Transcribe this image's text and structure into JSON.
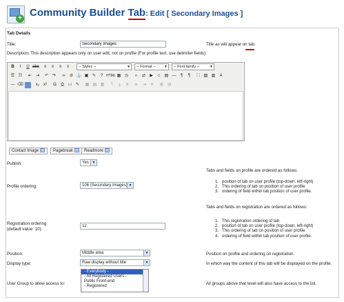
{
  "header": {
    "title_prefix": "Community Builder",
    "title_tab": "Tab",
    "title_suffix": ": Edit [ Secondary Images ]"
  },
  "section": "Tab Details",
  "fields": {
    "title_label": "Title:",
    "title_value": "Secondary Images",
    "title_help_pre": "Title as will appear on ",
    "title_help_tab": "tab",
    "title_help_end": ".",
    "desc_label": "Description: This description appears only on user edit, not on profile (For profile text, use delimiter fields):"
  },
  "editor": {
    "styles": "-- Styles --",
    "format": "-- Format --",
    "font": "-- Font family --",
    "buttons": [
      "Contact Image",
      "Pagebreak",
      "Readmore"
    ]
  },
  "publish": {
    "label": "Publish:",
    "value": "Yes"
  },
  "profile_ordering": {
    "label": "Profile ordering:",
    "value": "106 (Secondary Images)",
    "heading": "Tabs and fields on profile are ordered as follows:",
    "items": [
      "position of tab on user profile (top-down, left-right)",
      "This ordering of tab on position of user profile",
      "ordering of field within tab position of user profile."
    ]
  },
  "registration_ordering": {
    "label": "Registration ordering",
    "label2": "(default value: 10):",
    "value": "12",
    "heading": "Tabs and fields on registration are ordered as follows:",
    "items": [
      "This registration ordering of tab",
      "position of tab on user profile (top-down, left-right)",
      "This ordering of tab on position of user profile",
      "ordering of field within tab position of user profile."
    ]
  },
  "position": {
    "label": "Position:",
    "value": "Middle area",
    "help": "Position on profile and ordering on registration."
  },
  "display_type": {
    "label": "Display type:",
    "value": "Raw display without title",
    "help": "In which way the content of this tab will be displayed on the profile."
  },
  "user_group": {
    "label": "User Group to allow access to:",
    "options": [
      "- Everybody -",
      "- All Registered Users -",
      "Public Front-end",
      "- Registered"
    ],
    "help": "All groups above that level will also have access to the list."
  },
  "colors": {
    "title": "#1a4f97",
    "underline": "#d10000",
    "selected": "#3060c0"
  }
}
